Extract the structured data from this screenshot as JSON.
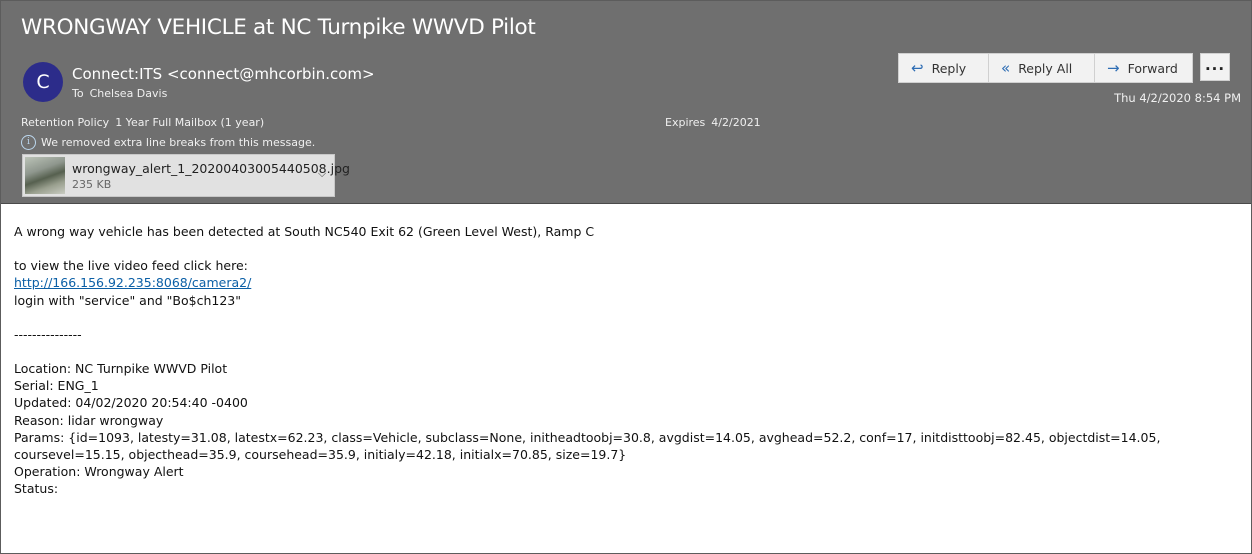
{
  "email": {
    "subject": "WRONGWAY VEHICLE at NC Turnpike WWVD Pilot",
    "sender": {
      "avatar_initial": "C",
      "display": "Connect:ITS <connect@mhcorbin.com>"
    },
    "to_label": "To",
    "to_name": "Chelsea Davis",
    "retention": {
      "label": "Retention Policy",
      "value": "1 Year Full Mailbox (1 year)"
    },
    "expires": {
      "label": "Expires",
      "value": "4/2/2021"
    },
    "info_notice": "We removed extra line breaks from this message.",
    "date": "Thu 4/2/2020 8:54 PM",
    "attachment": {
      "filename": "wrongway_alert_1_20200403005440508.jpg",
      "size": "235 KB"
    },
    "actions": {
      "reply": "Reply",
      "reply_all": "Reply All",
      "forward": "Forward",
      "more": "..."
    }
  },
  "body": {
    "line1": "A wrong way vehicle has been detected at South NC540 Exit 62 (Green Level West), Ramp C",
    "line2": "to view the live video feed click here:",
    "link": "http://166.156.92.235:8068/camera2/",
    "login": "login with \"service\" and \"Bo$ch123\"",
    "divider": "---------------",
    "location": "Location: NC Turnpike WWVD Pilot",
    "serial": "Serial: ENG_1",
    "updated": "Updated: 04/02/2020 20:54:40 -0400",
    "reason": "Reason: lidar wrongway",
    "params_1": "Params: {id=1093, latesty=31.08, latestx=62.23, class=Vehicle, subclass=None, initheadtoobj=30.8, avgdist=14.05, avghead=52.2, conf=17, initdisttoobj=82.45, objectdist=14.05,",
    "params_2": "coursevel=15.15, objecthead=35.9, coursehead=35.9, initialy=42.18, initialx=70.85, size=19.7}",
    "operation": "Operation: Wrongway Alert",
    "status": "Status:"
  },
  "icons": {
    "reply": "reply-arrow-icon",
    "reply_all": "reply-all-arrow-icon",
    "forward": "forward-arrow-icon",
    "info": "info-circle-icon",
    "chevron": "chevron-down-icon"
  }
}
